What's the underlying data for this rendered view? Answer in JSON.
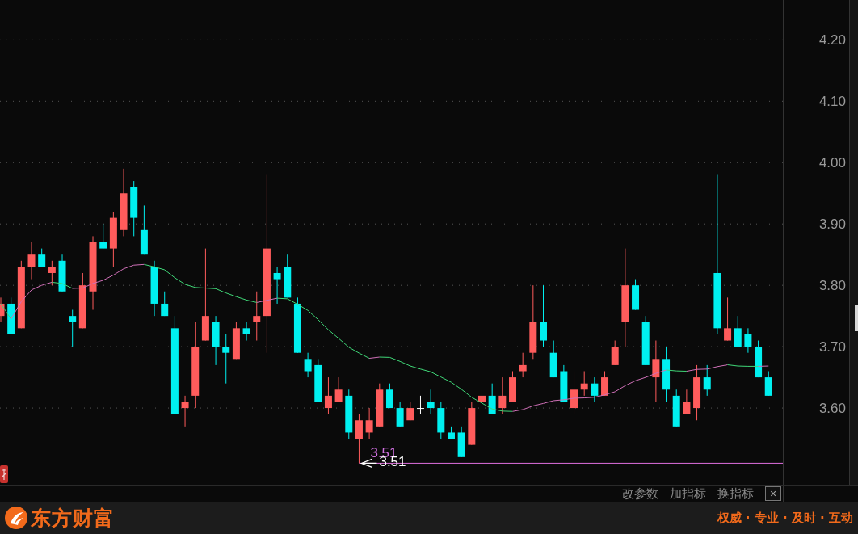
{
  "chart": {
    "chart_data": {
      "type": "candlestick",
      "grid": true,
      "ylim": [
        3.475,
        4.265
      ],
      "yticks": [
        {
          "value": 3.6,
          "label": "3.60"
        },
        {
          "value": 3.7,
          "label": "3.70"
        },
        {
          "value": 3.8,
          "label": "3.80"
        },
        {
          "value": 3.9,
          "label": "3.90"
        },
        {
          "value": 4.0,
          "label": "4.00"
        },
        {
          "value": 4.1,
          "label": "4.10"
        },
        {
          "value": 4.2,
          "label": "4.20"
        }
      ],
      "categories": [
        null,
        null,
        null,
        null,
        null,
        null,
        null,
        null,
        null,
        null,
        null,
        null,
        null,
        null,
        null,
        null,
        null,
        null,
        null,
        null,
        null,
        null,
        null,
        null,
        null,
        null,
        null,
        null,
        null,
        null,
        null,
        null,
        null,
        null,
        null,
        null,
        null,
        null,
        null,
        null,
        null,
        null,
        null,
        null,
        null,
        null,
        null,
        null,
        null,
        null,
        null,
        null,
        null,
        null,
        null,
        null,
        null,
        null,
        null,
        null,
        null,
        null,
        null,
        null,
        null,
        null,
        null,
        null,
        null,
        null,
        null,
        null,
        null,
        null,
        null,
        null
      ],
      "ohlc": [
        [
          3.75,
          3.78,
          3.74,
          3.77
        ],
        [
          3.77,
          3.78,
          3.72,
          3.72
        ],
        [
          3.73,
          3.84,
          3.73,
          3.83
        ],
        [
          3.83,
          3.87,
          3.81,
          3.85
        ],
        [
          3.85,
          3.86,
          3.83,
          3.83
        ],
        [
          3.82,
          3.84,
          3.8,
          3.83
        ],
        [
          3.84,
          3.85,
          3.79,
          3.79
        ],
        [
          3.75,
          3.76,
          3.7,
          3.74
        ],
        [
          3.73,
          3.82,
          3.73,
          3.8
        ],
        [
          3.79,
          3.88,
          3.76,
          3.87
        ],
        [
          3.87,
          3.9,
          3.86,
          3.86
        ],
        [
          3.86,
          3.92,
          3.83,
          3.91
        ],
        [
          3.89,
          3.99,
          3.88,
          3.95
        ],
        [
          3.96,
          3.97,
          3.88,
          3.91
        ],
        [
          3.89,
          3.93,
          3.85,
          3.85
        ],
        [
          3.83,
          3.84,
          3.75,
          3.77
        ],
        [
          3.77,
          3.79,
          3.75,
          3.75
        ],
        [
          3.73,
          3.75,
          3.59,
          3.59
        ],
        [
          3.6,
          3.62,
          3.57,
          3.61
        ],
        [
          3.62,
          3.74,
          3.6,
          3.7
        ],
        [
          3.71,
          3.86,
          3.71,
          3.75
        ],
        [
          3.74,
          3.75,
          3.67,
          3.7
        ],
        [
          3.7,
          3.72,
          3.64,
          3.69
        ],
        [
          3.68,
          3.74,
          3.68,
          3.73
        ],
        [
          3.73,
          3.74,
          3.71,
          3.72
        ],
        [
          3.74,
          3.79,
          3.71,
          3.75
        ],
        [
          3.75,
          3.98,
          3.69,
          3.86
        ],
        [
          3.82,
          3.83,
          3.77,
          3.81
        ],
        [
          3.83,
          3.85,
          3.78,
          3.78
        ],
        [
          3.77,
          3.78,
          3.69,
          3.69
        ],
        [
          3.68,
          3.69,
          3.65,
          3.66
        ],
        [
          3.67,
          3.68,
          3.61,
          3.61
        ],
        [
          3.6,
          3.65,
          3.59,
          3.62
        ],
        [
          3.61,
          3.65,
          3.61,
          3.63
        ],
        [
          3.62,
          3.63,
          3.55,
          3.56
        ],
        [
          3.55,
          3.59,
          3.51,
          3.58
        ],
        [
          3.56,
          3.6,
          3.55,
          3.58
        ],
        [
          3.57,
          3.64,
          3.57,
          3.63
        ],
        [
          3.63,
          3.64,
          3.6,
          3.6
        ],
        [
          3.6,
          3.61,
          3.57,
          3.57
        ],
        [
          3.58,
          3.61,
          3.58,
          3.6
        ],
        [
          3.6,
          3.62,
          3.59,
          3.6
        ],
        [
          3.61,
          3.63,
          3.59,
          3.6
        ],
        [
          3.6,
          3.61,
          3.55,
          3.56
        ],
        [
          3.56,
          3.57,
          3.55,
          3.55
        ],
        [
          3.56,
          3.57,
          3.52,
          3.52
        ],
        [
          3.54,
          3.61,
          3.54,
          3.6
        ],
        [
          3.61,
          3.63,
          3.61,
          3.62
        ],
        [
          3.62,
          3.64,
          3.59,
          3.59
        ],
        [
          3.6,
          3.65,
          3.59,
          3.62
        ],
        [
          3.61,
          3.66,
          3.61,
          3.65
        ],
        [
          3.66,
          3.69,
          3.65,
          3.67
        ],
        [
          3.69,
          3.8,
          3.68,
          3.74
        ],
        [
          3.74,
          3.8,
          3.7,
          3.71
        ],
        [
          3.69,
          3.71,
          3.65,
          3.65
        ],
        [
          3.66,
          3.67,
          3.61,
          3.61
        ],
        [
          3.6,
          3.66,
          3.59,
          3.63
        ],
        [
          3.63,
          3.66,
          3.62,
          3.64
        ],
        [
          3.64,
          3.65,
          3.61,
          3.62
        ],
        [
          3.62,
          3.66,
          3.62,
          3.65
        ],
        [
          3.67,
          3.71,
          3.67,
          3.7
        ],
        [
          3.74,
          3.86,
          3.7,
          3.8
        ],
        [
          3.8,
          3.81,
          3.76,
          3.76
        ],
        [
          3.74,
          3.75,
          3.67,
          3.67
        ],
        [
          3.65,
          3.71,
          3.61,
          3.68
        ],
        [
          3.68,
          3.7,
          3.61,
          3.63
        ],
        [
          3.62,
          3.63,
          3.57,
          3.57
        ],
        [
          3.59,
          3.63,
          3.59,
          3.61
        ],
        [
          3.6,
          3.67,
          3.58,
          3.65
        ],
        [
          3.65,
          3.67,
          3.62,
          3.63
        ],
        [
          3.82,
          3.98,
          3.72,
          3.73
        ],
        [
          3.71,
          3.78,
          3.71,
          3.73
        ],
        [
          3.73,
          3.75,
          3.7,
          3.7
        ],
        [
          3.72,
          3.73,
          3.69,
          3.7
        ],
        [
          3.7,
          3.71,
          3.65,
          3.65
        ],
        [
          3.65,
          3.66,
          3.62,
          3.62
        ]
      ],
      "annotations": [
        {
          "text": "3.51"
        },
        {
          "text": "3.51"
        }
      ]
    }
  },
  "toolbar": {
    "items": [
      "改参数",
      "加指标",
      "换指标"
    ],
    "close": "×"
  },
  "footer": {
    "brand": "东方财富",
    "slogan": "权威 · 专业 · 及时 · 互动"
  }
}
